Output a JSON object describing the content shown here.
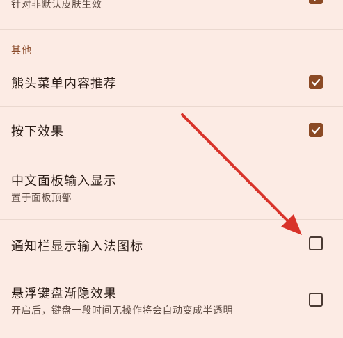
{
  "top_item": {
    "subtitle": "针对非默认皮肤生效",
    "checked": true
  },
  "section": {
    "header": "其他"
  },
  "items": [
    {
      "title": "熊头菜单内容推荐",
      "subtitle": "",
      "checked": true
    },
    {
      "title": "按下效果",
      "subtitle": "",
      "checked": true
    },
    {
      "title": "中文面板输入显示",
      "subtitle": "置于面板顶部"
    },
    {
      "title": "通知栏显示输入法图标",
      "subtitle": "",
      "checked": false
    },
    {
      "title": "悬浮键盘渐隐效果",
      "subtitle": "开启后，键盘一段时间无操作将会自动变成半透明",
      "checked": false
    }
  ],
  "colors": {
    "background": "#fcebe4",
    "accent": "#8b4a25",
    "section_header": "#8a4a2a",
    "annotation_arrow": "#d8332a"
  },
  "icons": {
    "checkbox_checked": "check-mark",
    "checkbox_unchecked": "empty-square"
  }
}
